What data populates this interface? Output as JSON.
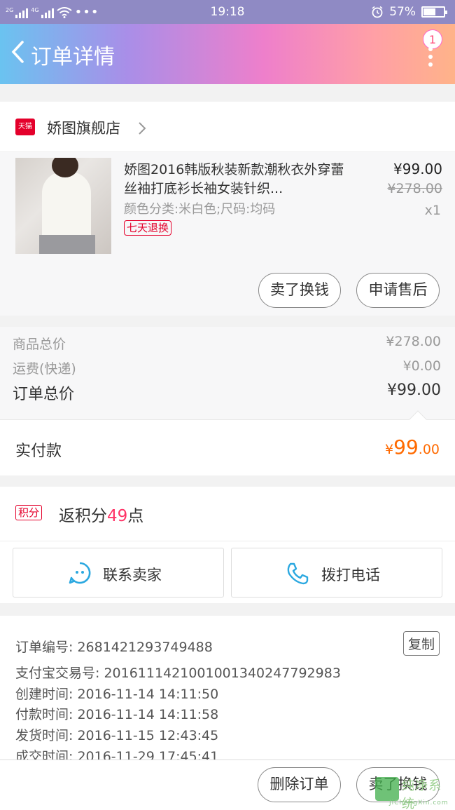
{
  "status_bar": {
    "time": "19:18",
    "battery": "57%",
    "battery_level": 0.57,
    "network_labels": [
      "2G",
      "4G"
    ]
  },
  "header": {
    "title": "订单详情",
    "badge_count": "1"
  },
  "shop": {
    "tmall_label": "天猫",
    "name": "娇图旗舰店"
  },
  "goods": {
    "title": "娇图2016韩版秋装新款潮秋衣外穿蕾丝袖打底衫长袖女装针织...",
    "spec": "颜色分类:米白色;尺码:均码",
    "tag": "七天退换",
    "price": "¥99.00",
    "original_price": "¥278.00",
    "quantity": "x1",
    "sell_button": "卖了换钱",
    "aftersale_button": "申请售后"
  },
  "prices": {
    "goods_total_label": "商品总价",
    "goods_total_value": "¥278.00",
    "shipping_label": "运费(快递)",
    "shipping_value": "¥0.00",
    "order_total_label": "订单总价",
    "order_total_value": "¥99.00"
  },
  "paid": {
    "label": "实付款",
    "currency": "¥",
    "integer": "99",
    "decimal": ".00"
  },
  "points": {
    "tag": "积分",
    "prefix": "返积分",
    "number": "49",
    "suffix": "点"
  },
  "contact": {
    "seller_label": "联系卖家",
    "phone_label": "拨打电话"
  },
  "order_info": {
    "copy_label": "复制",
    "rows": [
      "订单编号: 2681421293749488",
      "支付宝交易号: 2016111421001001340247792983",
      "创建时间: 2016-11-14 14:11:50",
      "付款时间: 2016-11-14 14:11:58",
      "发货时间: 2016-11-15 12:43:45",
      "成交时间: 2016-11-29 17:45:41"
    ]
  },
  "bottom_bar": {
    "delete_label": "删除订单",
    "sell_label": "卖了换钱"
  },
  "watermark": {
    "text": "纯净系统",
    "url": "JiChengXin.com"
  },
  "colors": {
    "accent_orange": "#ff6a00",
    "tmall_red": "#e4002b",
    "points_pink": "#ff3366"
  }
}
